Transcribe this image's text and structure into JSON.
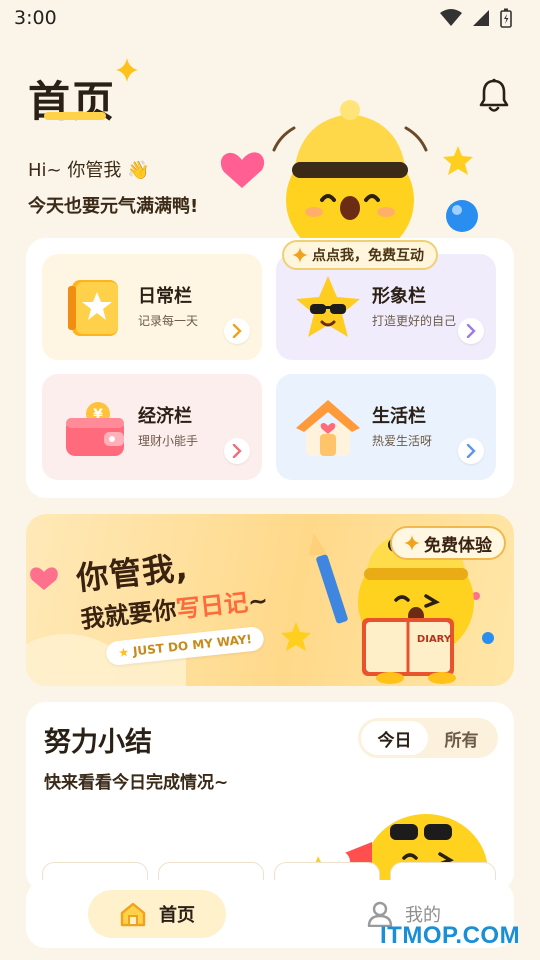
{
  "status_bar": {
    "time": "3:00"
  },
  "header": {
    "title": "首页"
  },
  "greeting": {
    "line1": "Hi~ 你管我 👋",
    "line2": "今天也要元气满满鸭!"
  },
  "mascot_badge": {
    "label": "点点我，免费互动"
  },
  "cards": [
    {
      "title": "日常栏",
      "subtitle": "记录每一天",
      "bg": "#fff5e3",
      "arrow_color": "#f0a21c"
    },
    {
      "title": "形象栏",
      "subtitle": "打造更好的自己",
      "bg": "#f1ecfb",
      "arrow_color": "#9b7ce0"
    },
    {
      "title": "经济栏",
      "subtitle": "理财小能手",
      "bg": "#fdeeee",
      "arrow_color": "#ef6f7a"
    },
    {
      "title": "生活栏",
      "subtitle": "热爱生活呀",
      "bg": "#eaf2fd",
      "arrow_color": "#5c97e8"
    }
  ],
  "banner": {
    "line1": "你管我,",
    "line2_prefix": "我就要你",
    "line2_highlight": "写日记",
    "line2_suffix": "~",
    "pill": "JUST DO MY WAY!",
    "cta": "免费体验",
    "book_label": "DIARY"
  },
  "summary": {
    "title": "努力小结",
    "subtitle": "快来看看今日完成情况~",
    "tabs": [
      "今日",
      "所有"
    ],
    "active_tab": "今日"
  },
  "bottom_nav": {
    "home": "首页",
    "mine": "我的"
  },
  "watermark": "ITMOP.COM",
  "colors": {
    "accent": "#ffd24a",
    "background": "#fbf5e9"
  }
}
